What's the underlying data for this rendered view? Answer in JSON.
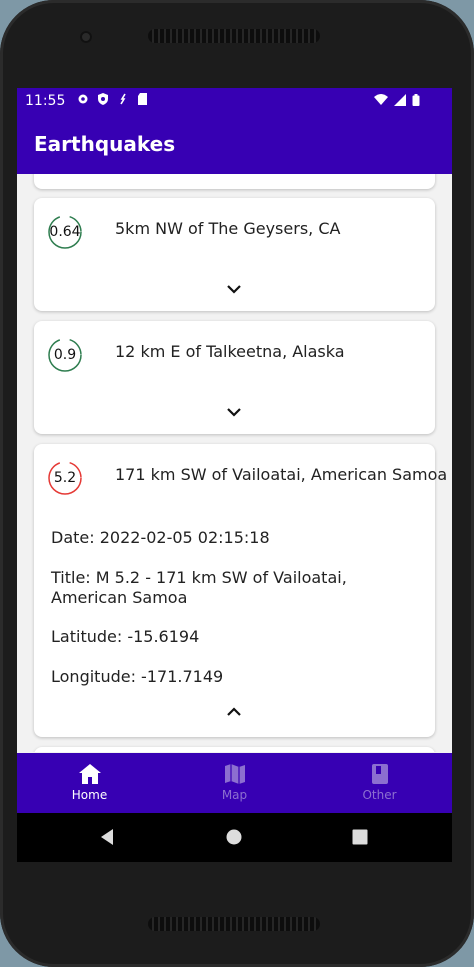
{
  "status_bar": {
    "time": "11:55"
  },
  "app_bar": {
    "title": "Earthquakes"
  },
  "earthquakes": [
    {
      "magnitude": "0.64",
      "place": "5km NW of The Geysers, CA",
      "ring_color": "#2e7d4f",
      "expanded": false
    },
    {
      "magnitude": "0.9",
      "place": "12 km E of Talkeetna, Alaska",
      "ring_color": "#2e7d4f",
      "expanded": false
    },
    {
      "magnitude": "5.2",
      "place": "171 km SW of Vailoatai, American Samoa",
      "ring_color": "#e53935",
      "expanded": true,
      "date": "Date: 2022-02-05 02:15:18",
      "title": "Title: M 5.2 - 171 km SW of Vailoatai, American Samoa",
      "latitude": "Latitude: -15.6194",
      "longitude": "Longitude: -171.7149"
    }
  ],
  "bottom_nav": {
    "items": [
      {
        "label": "Home",
        "icon": "home-icon",
        "active": true
      },
      {
        "label": "Map",
        "icon": "map-icon",
        "active": false
      },
      {
        "label": "Other",
        "icon": "book-icon",
        "active": false
      }
    ]
  },
  "colors": {
    "primary": "#3700b3",
    "inactive_nav": "#8c6fd0"
  }
}
